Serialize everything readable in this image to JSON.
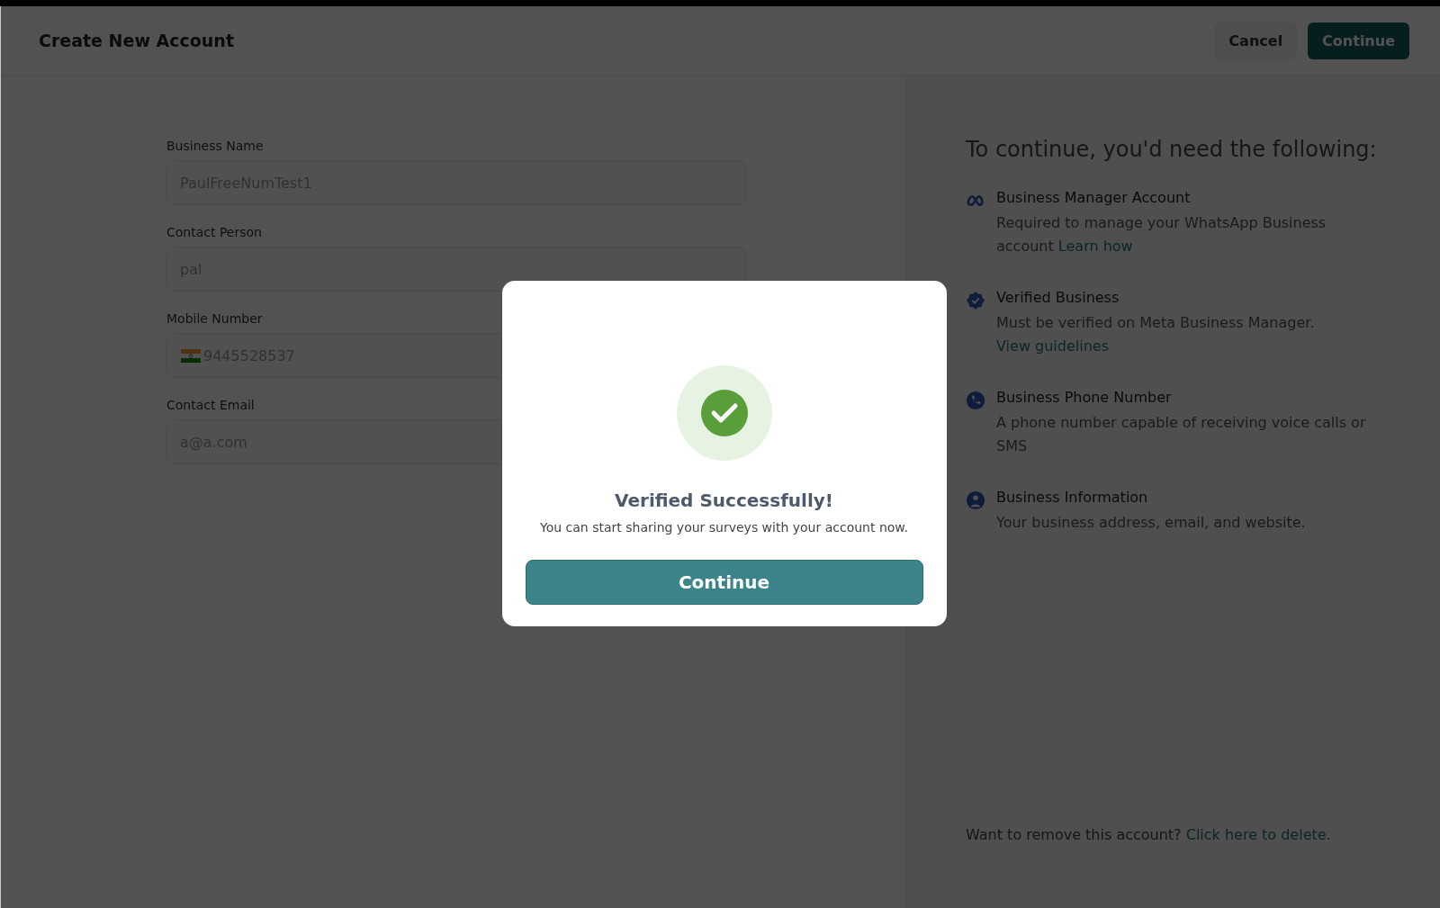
{
  "header": {
    "title": "Create New Account",
    "buttons": [
      {
        "label": "Cancel",
        "kind": "secondary"
      },
      {
        "label": "Continue",
        "kind": "primary"
      }
    ]
  },
  "form": {
    "fields": [
      {
        "label": "Business Name",
        "value": "PaulFreeNumTest1",
        "kind": "text"
      },
      {
        "label": "Contact Person",
        "value": "pal",
        "kind": "text"
      },
      {
        "label": "Mobile Number",
        "value": "9445528537",
        "kind": "phone"
      },
      {
        "label": "Contact Email",
        "value": "a@a.com",
        "kind": "text"
      }
    ]
  },
  "requirements": {
    "heading": "To continue, you'd need the following:",
    "items": [
      {
        "kind": "meta",
        "title": "Business Manager Account",
        "text": "Required to manage your WhatsApp Business account",
        "link": "Learn how"
      },
      {
        "kind": "verified",
        "title": "Verified Business",
        "text": "Must be verified on Meta Business Manager.",
        "link": "View guidelines"
      },
      {
        "kind": "phone",
        "title": "Business Phone Number",
        "text": "A phone number capable of receiving voice calls or SMS"
      },
      {
        "kind": "person",
        "title": "Business Information",
        "text": "Your business address, email, and website."
      }
    ],
    "footer": {
      "text": "Want to remove this account?",
      "link": "Click here to delete."
    }
  },
  "dialog": {
    "title": "Verified Successfully!",
    "message": "You can start sharing your surveys with your account now.",
    "button": "Continue"
  }
}
